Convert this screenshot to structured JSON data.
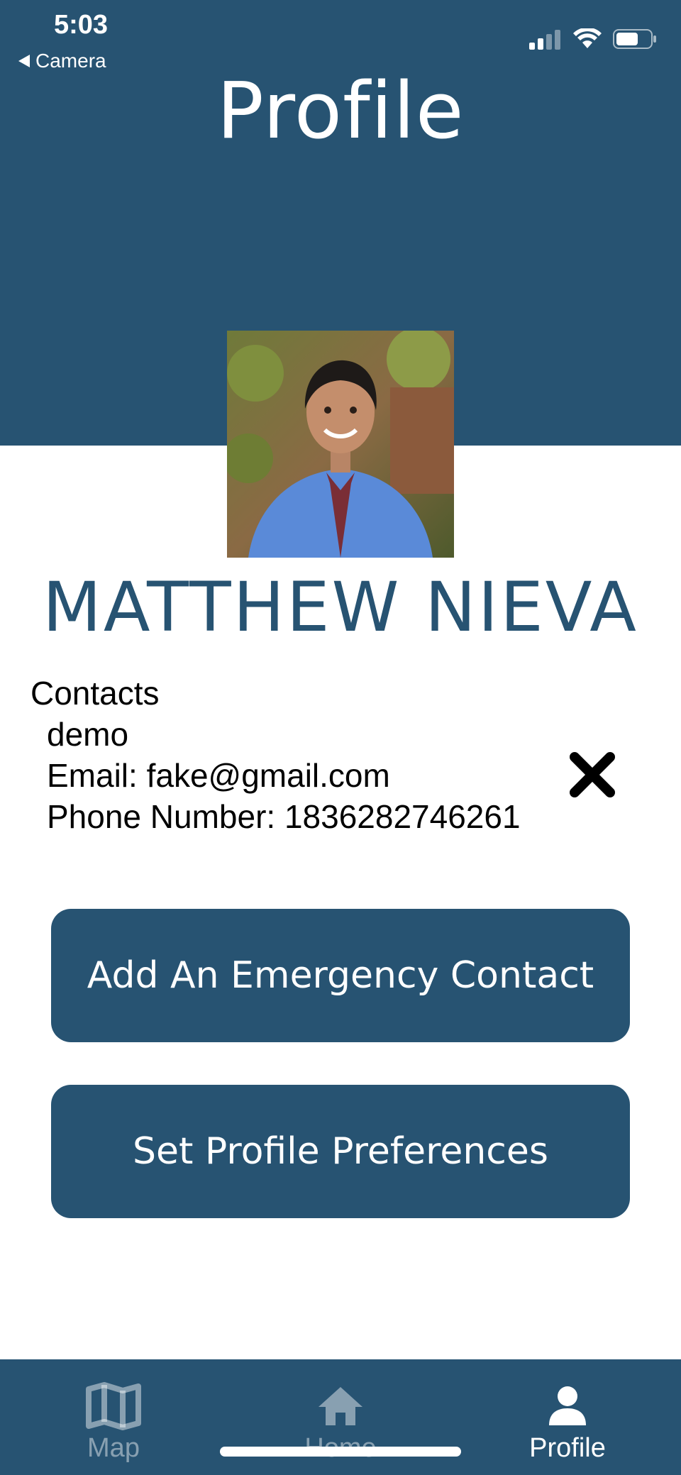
{
  "status_bar": {
    "time": "5:03",
    "back_label": "Camera"
  },
  "header": {
    "title": "Profile"
  },
  "profile": {
    "name": "MATTHEW NIEVA"
  },
  "contacts": {
    "heading": "Contacts",
    "items": [
      {
        "name": "demo",
        "email": "Email: fake@gmail.com",
        "phone": "Phone Number: 1836282746261"
      }
    ]
  },
  "buttons": {
    "add_contact": "Add An Emergency Contact",
    "preferences": "Set Profile Preferences"
  },
  "tabbar": {
    "tabs": [
      {
        "label": "Map",
        "icon": "map-icon",
        "active": false
      },
      {
        "label": "Home",
        "icon": "home-icon",
        "active": false
      },
      {
        "label": "Profile",
        "icon": "person-icon",
        "active": true
      }
    ]
  },
  "colors": {
    "brand": "#275372",
    "background": "#ffffff"
  }
}
